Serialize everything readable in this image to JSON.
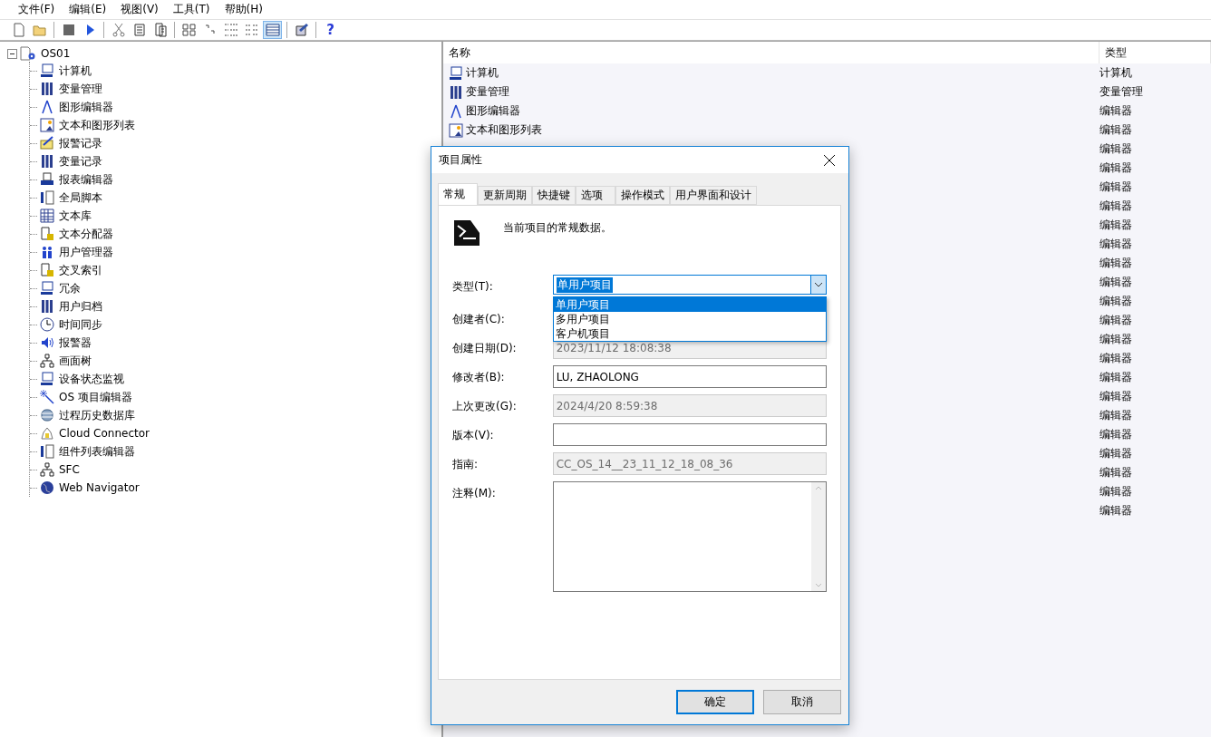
{
  "menu": [
    "文件(F)",
    "编辑(E)",
    "视图(V)",
    "工具(T)",
    "帮助(H)"
  ],
  "toolbar": [
    {
      "kind": "new",
      "selected": false
    },
    {
      "kind": "open",
      "selected": false
    },
    {
      "kind": "sep"
    },
    {
      "kind": "stop",
      "selected": false
    },
    {
      "kind": "run",
      "selected": false
    },
    {
      "kind": "sep"
    },
    {
      "kind": "cut",
      "selected": false
    },
    {
      "kind": "copy",
      "selected": false
    },
    {
      "kind": "paste",
      "selected": false
    },
    {
      "kind": "sep"
    },
    {
      "kind": "large",
      "selected": false
    },
    {
      "kind": "small",
      "selected": false
    },
    {
      "kind": "list",
      "selected": false
    },
    {
      "kind": "tiles",
      "selected": false
    },
    {
      "kind": "details",
      "selected": true
    },
    {
      "kind": "sep"
    },
    {
      "kind": "props",
      "selected": false
    },
    {
      "kind": "sep"
    },
    {
      "kind": "help",
      "label": "?",
      "selected": false
    }
  ],
  "tree": {
    "label": "OS01",
    "expanded": true,
    "children": [
      {
        "label": "计算机",
        "kind": "monitor"
      },
      {
        "label": "变量管理",
        "kind": "bars"
      },
      {
        "label": "图形编辑器",
        "kind": "compass"
      },
      {
        "label": "文本和图形列表",
        "kind": "list"
      },
      {
        "label": "报警记录",
        "kind": "mail"
      },
      {
        "label": "变量记录",
        "kind": "bars"
      },
      {
        "label": "报表编辑器",
        "kind": "printer"
      },
      {
        "label": "全局脚本",
        "kind": "script"
      },
      {
        "label": "文本库",
        "kind": "grid"
      },
      {
        "label": "文本分配器",
        "kind": "doc"
      },
      {
        "label": "用户管理器",
        "kind": "users"
      },
      {
        "label": "交叉索引",
        "kind": "doc"
      },
      {
        "label": "冗余",
        "kind": "monitor"
      },
      {
        "label": "用户归档",
        "kind": "bars"
      },
      {
        "label": "时间同步",
        "kind": "clock"
      },
      {
        "label": "报警器",
        "kind": "speaker"
      },
      {
        "label": "画面树",
        "kind": "tree"
      },
      {
        "label": "设备状态监视",
        "kind": "monitor"
      },
      {
        "label": "OS 项目编辑器",
        "kind": "wand"
      },
      {
        "label": "过程历史数据库",
        "kind": "db"
      },
      {
        "label": "Cloud Connector",
        "kind": "cloud"
      },
      {
        "label": "组件列表编辑器",
        "kind": "script"
      },
      {
        "label": "SFC",
        "kind": "tree"
      },
      {
        "label": "Web Navigator",
        "kind": "globe"
      }
    ]
  },
  "list": {
    "columns": [
      "名称",
      "类型"
    ],
    "rows": [
      {
        "name": "计算机",
        "kind": "monitor",
        "type": "计算机"
      },
      {
        "name": "变量管理",
        "kind": "bars",
        "type": "变量管理"
      },
      {
        "name": "图形编辑器",
        "kind": "compass",
        "type": "编辑器"
      },
      {
        "name": "文本和图形列表",
        "kind": "list",
        "type": "编辑器"
      },
      {
        "type": "编辑器"
      },
      {
        "type": "编辑器"
      },
      {
        "type": "编辑器"
      },
      {
        "type": "编辑器"
      },
      {
        "type": "编辑器"
      },
      {
        "type": "编辑器"
      },
      {
        "type": "编辑器"
      },
      {
        "type": "编辑器"
      },
      {
        "type": "编辑器"
      },
      {
        "type": "编辑器"
      },
      {
        "type": "编辑器"
      },
      {
        "type": "编辑器"
      },
      {
        "type": "编辑器"
      },
      {
        "type": "编辑器"
      },
      {
        "type": "编辑器"
      },
      {
        "type": "编辑器"
      },
      {
        "type": "编辑器"
      },
      {
        "type": "编辑器"
      },
      {
        "type": "编辑器"
      },
      {
        "type": "编辑器"
      }
    ]
  },
  "dialog": {
    "title": "项目属性",
    "tabs": [
      {
        "label": "常规",
        "selected": true
      },
      {
        "label": "更新周期",
        "selected": false
      },
      {
        "label": "快捷键",
        "selected": false
      },
      {
        "label": "选项",
        "selected": false
      },
      {
        "label": "操作模式",
        "selected": false
      },
      {
        "label": "用户界面和设计",
        "selected": false
      }
    ],
    "description": "当前项目的常规数据。",
    "fields": [
      {
        "label": "类型(T):",
        "kind": "combo",
        "value": "单用户项目",
        "expanded": true,
        "options": [
          {
            "label": "单用户项目",
            "selected": true
          },
          {
            "label": "多用户项目",
            "selected": false
          },
          {
            "label": "客户机项目",
            "selected": false
          }
        ]
      },
      {
        "label": "创建者(C):",
        "kind": "hidden"
      },
      {
        "label": "创建日期(D):",
        "kind": "text",
        "value": "2023/11/12 18:08:38",
        "disabled": true
      },
      {
        "label": "修改者(B):",
        "kind": "text",
        "value": "LU, ZHAOLONG",
        "disabled": false
      },
      {
        "label": "上次更改(G):",
        "kind": "text",
        "value": "2024/4/20 8:59:38",
        "disabled": true
      },
      {
        "label": "版本(V):",
        "kind": "text",
        "disabled": false
      },
      {
        "label": "指南:",
        "kind": "text",
        "value": "CC_OS_14__23_11_12_18_08_36",
        "disabled": true
      },
      {
        "label": "注释(M):",
        "kind": "textarea"
      }
    ],
    "buttons": [
      {
        "label": "确定",
        "default": true
      },
      {
        "label": "取消",
        "default": false
      }
    ]
  }
}
